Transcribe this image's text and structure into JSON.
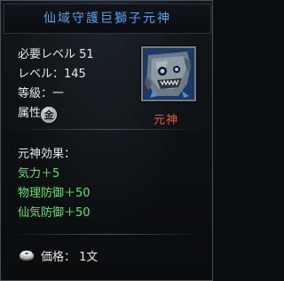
{
  "title": "仙域守護巨獅子元神",
  "stats": {
    "required_level_label": "必要レベル",
    "required_level_value": "51",
    "level_label": "レベル：",
    "level_value": "145",
    "grade_label": "等級：",
    "grade_value": "一",
    "attribute_label": "属性：",
    "attribute_icon_glyph": "金",
    "attribute_icon": "metal-element-icon"
  },
  "portrait_icon": "lion-spirit-portrait",
  "type_label": "元神",
  "effects": {
    "title": "元神効果：",
    "items": [
      "気力＋5",
      "物理防御＋50",
      "仙気防御＋50"
    ]
  },
  "price": {
    "icon": "coin-icon",
    "label": "価格：",
    "value": "1文"
  },
  "colors": {
    "title": "#56a2ee",
    "effect": "#58e86a",
    "type": "#e45a3a",
    "text": "#e8e8e8"
  }
}
